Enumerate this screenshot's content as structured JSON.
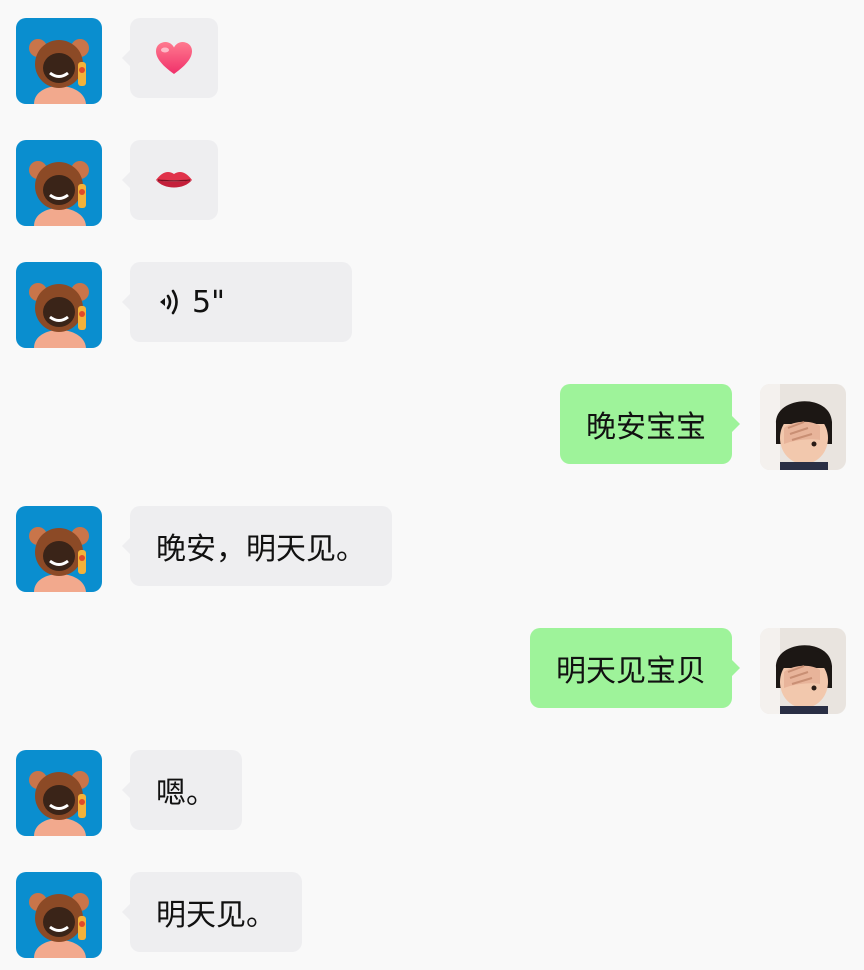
{
  "chat": {
    "messages": [
      {
        "id": 1,
        "side": "left",
        "kind": "emoji",
        "icon": "heart-icon"
      },
      {
        "id": 2,
        "side": "left",
        "kind": "emoji",
        "icon": "lips-icon"
      },
      {
        "id": 3,
        "side": "left",
        "kind": "voice",
        "duration": "5\""
      },
      {
        "id": 4,
        "side": "right",
        "kind": "text",
        "text": "晚安宝宝"
      },
      {
        "id": 5,
        "side": "left",
        "kind": "text",
        "text": "晚安，明天见。"
      },
      {
        "id": 6,
        "side": "right",
        "kind": "text",
        "text": "明天见宝贝"
      },
      {
        "id": 7,
        "side": "left",
        "kind": "text",
        "text": "嗯。"
      },
      {
        "id": 8,
        "side": "left",
        "kind": "text",
        "text": "明天见。"
      }
    ]
  },
  "colors": {
    "background": "#f9f9f9",
    "incoming_bubble": "#eeeef0",
    "outgoing_bubble": "#9ef39a",
    "contact_avatar_bg": "#0a8ecf",
    "heart": "#f0506e",
    "lips": "#e0324a"
  }
}
